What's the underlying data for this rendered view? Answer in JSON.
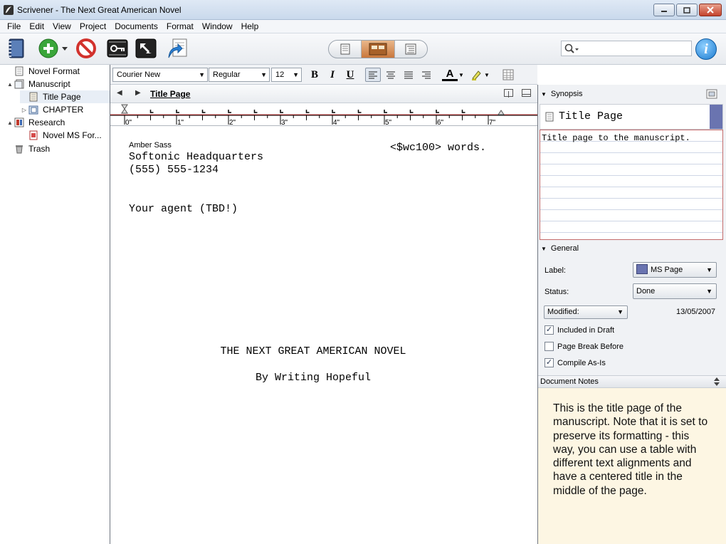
{
  "window": {
    "title": "Scrivener - The Next Great American Novel"
  },
  "window_controls": [
    "minimize",
    "maximize",
    "close"
  ],
  "menu": [
    "File",
    "Edit",
    "View",
    "Project",
    "Documents",
    "Format",
    "Window",
    "Help"
  ],
  "toolbar": {
    "search_placeholder": "",
    "info_label": "i",
    "view_mode_active": "corkboard"
  },
  "binder": {
    "items": [
      {
        "label": "Novel Format",
        "icon": "document-icon",
        "level": 0,
        "expander": ""
      },
      {
        "label": "Manuscript",
        "icon": "manuscript-icon",
        "level": 0,
        "expander": "▲"
      },
      {
        "label": "Title Page",
        "icon": "page-icon",
        "level": 1,
        "expander": "",
        "selected": true
      },
      {
        "label": "CHAPTER",
        "icon": "folder-icon",
        "level": 1,
        "expander": "▷"
      },
      {
        "label": "Research",
        "icon": "research-icon",
        "level": 0,
        "expander": "▲"
      },
      {
        "label": "Novel MS For...",
        "icon": "pdf-icon",
        "level": 1,
        "expander": ""
      },
      {
        "label": "Trash",
        "icon": "trash-icon",
        "level": 0,
        "expander": ""
      }
    ]
  },
  "format": {
    "font": "Courier New",
    "style": "Regular",
    "size": "12",
    "bold": "B",
    "italic": "I",
    "underline": "U",
    "text_color_label": "A"
  },
  "editor": {
    "title": "Title Page",
    "ruler_labels": [
      "0\"",
      "1\"",
      "2\"",
      "3\"",
      "4\"",
      "5\"",
      "6\"",
      "7\""
    ],
    "author": "Amber Sass",
    "word_count": "<$wc100> words.",
    "address": "Softonic Headquarters",
    "phone": "(555) 555-1234",
    "agent": "Your agent (TBD!)",
    "book_title": "THE NEXT GREAT AMERICAN NOVEL",
    "byline": "By Writing Hopeful"
  },
  "inspector": {
    "synopsis_header": "Synopsis",
    "synopsis_title": "Title Page",
    "synopsis_text": "Title page to the manuscript.",
    "general_header": "General",
    "label_label": "Label:",
    "label_value": "MS Page",
    "label_color": "#6a74b0",
    "status_label": "Status:",
    "status_value": "Done",
    "date_field": "Modified:",
    "date_value": "13/05/2007",
    "included_in_draft": "Included in Draft",
    "included_checked": true,
    "page_break_before": "Page Break Before",
    "page_break_checked": false,
    "compile_as_is": "Compile As-Is",
    "compile_checked": true,
    "notes_header": "Document Notes",
    "notes_text": "This is the title page of the manuscript. Note that it is set to preserve its formatting - this way, you can use a table with different text alignments and have a centered title in the middle of the page."
  }
}
